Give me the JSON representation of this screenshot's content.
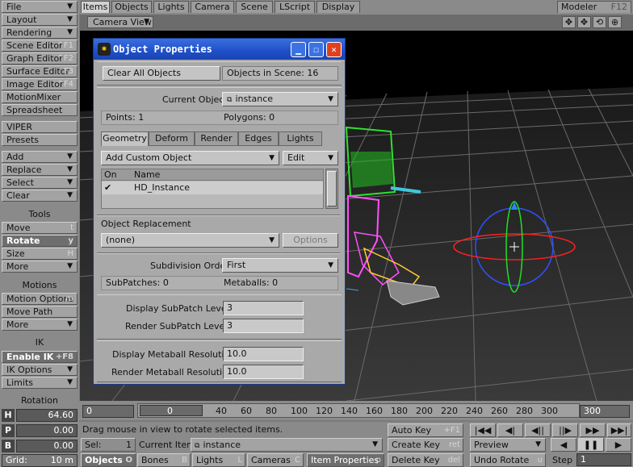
{
  "left_panel": {
    "file": "File",
    "layout": "Layout",
    "rendering": "Rendering",
    "scene_editor": "Scene Editor",
    "scene_editor_sc": "^F1",
    "graph_editor": "Graph Editor",
    "graph_editor_sc": "^F2",
    "surface_editor": "Surface Editor",
    "surface_editor_sc": "F3",
    "image_editor": "Image Editor",
    "image_editor_sc": "^F4",
    "motion_mixer": "MotionMixer",
    "spreadsheet": "Spreadsheet",
    "viper": "VIPER",
    "presets": "Presets",
    "add": "Add",
    "replace": "Replace",
    "select": "Select",
    "clear": "Clear",
    "tools_header": "Tools",
    "move": "Move",
    "move_sc": "t",
    "rotate": "Rotate",
    "rotate_sc": "y",
    "size": "Size",
    "size_sc": "H",
    "more1": "More",
    "motions_header": "Motions",
    "motion_options": "Motion Options",
    "motion_options_sc": "m",
    "move_path": "Move Path",
    "more2": "More",
    "ik_header": "IK",
    "enable_ik": "Enable IK",
    "enable_ik_sc": "+F8",
    "ik_options": "IK Options",
    "limits": "Limits",
    "rotation_header": "Rotation"
  },
  "tabs": {
    "items": "Items",
    "objects": "Objects",
    "lights": "Lights",
    "camera": "Camera",
    "scene": "Scene",
    "lscript": "LScript",
    "display": "Display",
    "modeler": "Modeler",
    "modeler_sc": "F12"
  },
  "viewport": {
    "view_mode": "Camera View"
  },
  "dialog": {
    "title": "Object Properties",
    "clear_all": "Clear All Objects",
    "objects_in_scene": "Objects in Scene: 16",
    "current_object_label": "Current Object",
    "current_object": "instance",
    "points": "Points: 1",
    "polygons": "Polygons: 0",
    "tabs": [
      "Geometry",
      "Deform",
      "Render",
      "Edges",
      "Lights"
    ],
    "add_custom": "Add Custom Object",
    "edit": "Edit",
    "col_on": "On",
    "col_name": "Name",
    "row_name": "HD_Instance",
    "replacement_label": "Object Replacement",
    "replacement_value": "(none)",
    "options": "Options",
    "subdiv_label": "Subdivision Order",
    "subdiv_value": "First",
    "subpatches": "SubPatches: 0",
    "metaballs": "Metaballs: 0",
    "display_subpatch_label": "Display SubPatch Level",
    "display_subpatch_value": "3",
    "render_subpatch_label": "Render SubPatch Level",
    "render_subpatch_value": "3",
    "display_meta_label": "Display Metaball Resolution",
    "display_meta_value": "10.0",
    "render_meta_label": "Render Metaball Resolution",
    "render_meta_value": "10.0"
  },
  "timeline": {
    "start": "0",
    "end": "300",
    "current": "0",
    "ticks": [
      "0",
      "40",
      "60",
      "80",
      "100",
      "120",
      "140",
      "160",
      "180",
      "200",
      "220",
      "240",
      "260",
      "280",
      "300"
    ]
  },
  "bottom": {
    "h_label": "H",
    "h_value": "64.60",
    "p_label": "P",
    "p_value": "0.00",
    "b_label": "B",
    "b_value": "0.00",
    "grid_label": "Grid:",
    "grid_value": "10 m",
    "status": "Drag mouse in view to rotate selected items.",
    "sel_label": "Sel:",
    "sel_value": "1",
    "current_item_label": "Current Item",
    "current_item_value": "instance",
    "objects": "Objects",
    "objects_sc": "O",
    "bones": "Bones",
    "bones_sc": "B",
    "lights": "Lights",
    "lights_sc": "L",
    "cameras": "Cameras",
    "cameras_sc": "C",
    "item_properties": "Item Properties",
    "item_properties_sc": "p",
    "auto_key": "Auto Key",
    "auto_key_sc": "+F1",
    "create_key": "Create Key",
    "create_key_sc": "ret",
    "delete_key": "Delete Key",
    "delete_key_sc": "del",
    "preview": "Preview",
    "undo_rotate": "Undo Rotate",
    "undo_rotate_sc": "u",
    "step_label": "Step",
    "step_value": "1"
  }
}
